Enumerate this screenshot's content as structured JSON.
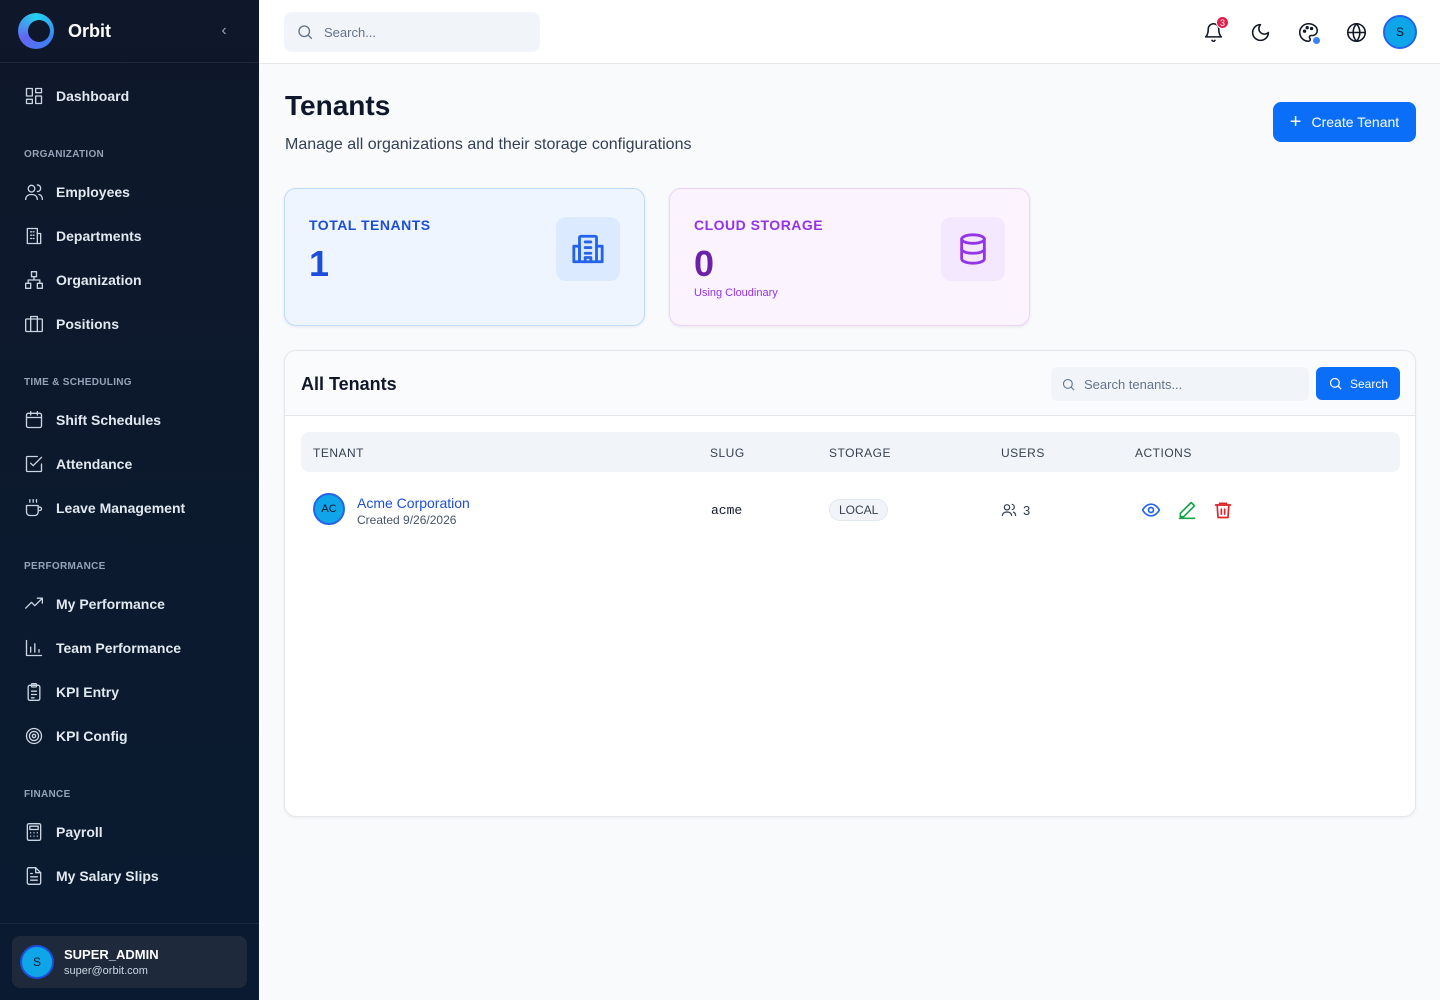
{
  "sidebar": {
    "brand": "Orbit",
    "dashboard": "Dashboard",
    "sections": {
      "organization": "ORGANIZATION",
      "time": "TIME & SCHEDULING",
      "performance": "PERFORMANCE",
      "finance": "FINANCE"
    },
    "items": {
      "employees": "Employees",
      "departments": "Departments",
      "organization": "Organization",
      "positions": "Positions",
      "shift_schedules": "Shift Schedules",
      "attendance": "Attendance",
      "leave_management": "Leave Management",
      "my_performance": "My Performance",
      "team_performance": "Team Performance",
      "kpi_entry": "KPI Entry",
      "kpi_config": "KPI Config",
      "payroll": "Payroll",
      "my_salary_slips": "My Salary Slips"
    },
    "user": {
      "initial": "S",
      "name": "SUPER_ADMIN",
      "email": "super@orbit.com"
    }
  },
  "topbar": {
    "search_placeholder": "Search...",
    "notification_count": "3",
    "avatar_initial": "S"
  },
  "page": {
    "title": "Tenants",
    "subtitle": "Manage all organizations and their storage configurations",
    "create_button": "Create Tenant"
  },
  "stats": {
    "total": {
      "label": "TOTAL TENANTS",
      "value": "1"
    },
    "storage": {
      "label": "CLOUD STORAGE",
      "value": "0",
      "sub": "Using Cloudinary"
    }
  },
  "table": {
    "title": "All Tenants",
    "search_placeholder": "Search tenants...",
    "search_button": "Search",
    "columns": [
      "TENANT",
      "SLUG",
      "STORAGE",
      "USERS",
      "ACTIONS"
    ],
    "rows": [
      {
        "initials": "AC",
        "name": "Acme Corporation",
        "created": "Created 9/26/2026",
        "slug": "acme",
        "storage": "LOCAL",
        "users": "3"
      }
    ]
  },
  "colors": {
    "primary": "#0b6ef9",
    "sidebar_bg": "#0f172a",
    "danger": "#dc2626",
    "success": "#16a34a"
  }
}
